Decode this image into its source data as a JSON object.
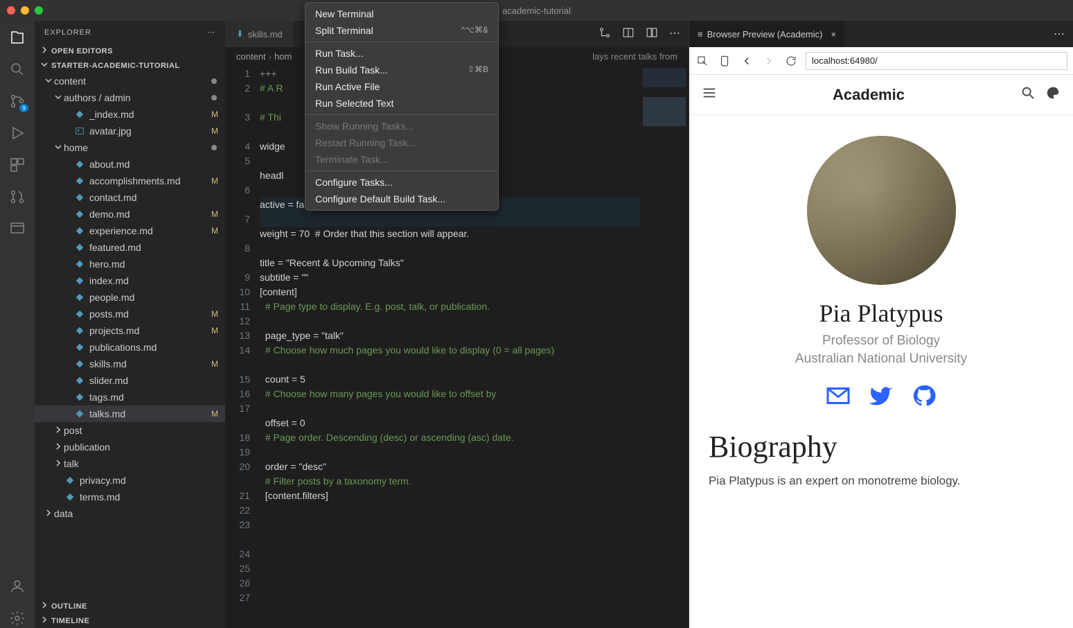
{
  "window": {
    "title": "academic-tutorial"
  },
  "explorer": {
    "title": "EXPLORER",
    "sections": {
      "open_editors": "OPEN EDITORS",
      "project": "STARTER-ACADEMIC-TUTORIAL",
      "outline": "OUTLINE",
      "timeline": "TIMELINE"
    },
    "tree": [
      {
        "label": "content",
        "kind": "folder",
        "depth": 0,
        "expanded": true,
        "status": "dot"
      },
      {
        "label": "authors / admin",
        "kind": "folder",
        "depth": 1,
        "expanded": true,
        "status": "dot"
      },
      {
        "label": "_index.md",
        "kind": "md",
        "depth": 2,
        "status": "M"
      },
      {
        "label": "avatar.jpg",
        "kind": "img",
        "depth": 2,
        "status": "M"
      },
      {
        "label": "home",
        "kind": "folder",
        "depth": 1,
        "expanded": true,
        "status": "dot"
      },
      {
        "label": "about.md",
        "kind": "md",
        "depth": 2
      },
      {
        "label": "accomplishments.md",
        "kind": "md",
        "depth": 2,
        "status": "M"
      },
      {
        "label": "contact.md",
        "kind": "md",
        "depth": 2
      },
      {
        "label": "demo.md",
        "kind": "md",
        "depth": 2,
        "status": "M"
      },
      {
        "label": "experience.md",
        "kind": "md",
        "depth": 2,
        "status": "M"
      },
      {
        "label": "featured.md",
        "kind": "md",
        "depth": 2
      },
      {
        "label": "hero.md",
        "kind": "md",
        "depth": 2
      },
      {
        "label": "index.md",
        "kind": "md",
        "depth": 2
      },
      {
        "label": "people.md",
        "kind": "md",
        "depth": 2
      },
      {
        "label": "posts.md",
        "kind": "md",
        "depth": 2,
        "status": "M"
      },
      {
        "label": "projects.md",
        "kind": "md",
        "depth": 2,
        "status": "M"
      },
      {
        "label": "publications.md",
        "kind": "md",
        "depth": 2
      },
      {
        "label": "skills.md",
        "kind": "md",
        "depth": 2,
        "status": "M"
      },
      {
        "label": "slider.md",
        "kind": "md",
        "depth": 2
      },
      {
        "label": "tags.md",
        "kind": "md",
        "depth": 2
      },
      {
        "label": "talks.md",
        "kind": "md",
        "depth": 2,
        "status": "M",
        "selected": true
      },
      {
        "label": "post",
        "kind": "folder",
        "depth": 1,
        "expanded": false
      },
      {
        "label": "publication",
        "kind": "folder",
        "depth": 1,
        "expanded": false
      },
      {
        "label": "talk",
        "kind": "folder",
        "depth": 1,
        "expanded": false
      },
      {
        "label": "privacy.md",
        "kind": "md",
        "depth": 1
      },
      {
        "label": "terms.md",
        "kind": "md",
        "depth": 1
      },
      {
        "label": "data",
        "kind": "folder",
        "depth": 0,
        "expanded": false
      }
    ]
  },
  "sourcecontrol_badge": "9",
  "editor": {
    "tab": "skills.md",
    "breadcrumb": [
      "content",
      "hom"
    ],
    "breadcrumb_tail": "lays recent talks from ",
    "lines": [
      {
        "n": 1,
        "text": "+++",
        "cls": "c-front"
      },
      {
        "n": 2,
        "text": "# A R                              reated with",
        "cls": "c-comment",
        "wrap": true
      },
      {
        "n": 3,
        "text": "# Thi                              m `content",
        "cls": "c-comment",
        "wrap": true
      },
      {
        "n": 4,
        "text": "",
        "cls": ""
      },
      {
        "n": 5,
        "text": "widge                              nemes.com/a",
        "cls": "",
        "wrap": true
      },
      {
        "n": 6,
        "text": "headl                              a page section.",
        "cls": "",
        "wrap": true
      },
      {
        "n": 7,
        "text": "active = false  # Activate this widget? true/false",
        "cls": "",
        "hl": true,
        "wrap": true
      },
      {
        "n": 8,
        "text": "weight = 70  # Order that this section will appear.",
        "cls": "",
        "wrap": true
      },
      {
        "n": 9,
        "text": "",
        "cls": ""
      },
      {
        "n": 10,
        "text": "title = \"Recent & Upcoming Talks\"",
        "cls": ""
      },
      {
        "n": 11,
        "text": "subtitle = \"\"",
        "cls": ""
      },
      {
        "n": 12,
        "text": "",
        "cls": ""
      },
      {
        "n": 13,
        "text": "[content]",
        "cls": "c-section"
      },
      {
        "n": 14,
        "text": "  # Page type to display. E.g. post, talk, or publication.",
        "cls": "c-comment",
        "wrap": true
      },
      {
        "n": 15,
        "text": "  page_type = \"talk\"",
        "cls": ""
      },
      {
        "n": 16,
        "text": "",
        "cls": ""
      },
      {
        "n": 17,
        "text": "  # Choose how much pages you would like to display (0 = all pages)",
        "cls": "c-comment",
        "wrap": true
      },
      {
        "n": 18,
        "text": "  count = 5",
        "cls": ""
      },
      {
        "n": 19,
        "text": "",
        "cls": ""
      },
      {
        "n": 20,
        "text": "  # Choose how many pages you would like to offset by",
        "cls": "c-comment",
        "wrap": true
      },
      {
        "n": 21,
        "text": "  offset = 0",
        "cls": ""
      },
      {
        "n": 22,
        "text": "",
        "cls": ""
      },
      {
        "n": 23,
        "text": "  # Page order. Descending (desc) or ascending (asc) date.",
        "cls": "c-comment",
        "wrap": true
      },
      {
        "n": 24,
        "text": "  order = \"desc\"",
        "cls": ""
      },
      {
        "n": 25,
        "text": "",
        "cls": ""
      },
      {
        "n": 26,
        "text": "  # Filter posts by a taxonomy term.",
        "cls": "c-comment"
      },
      {
        "n": 27,
        "text": "  [content.filters]",
        "cls": "c-section"
      }
    ]
  },
  "menu": {
    "items": [
      {
        "label": "New Terminal"
      },
      {
        "label": "Split Terminal",
        "shortcut": "^⌥⌘&"
      },
      {
        "sep": true
      },
      {
        "label": "Run Task..."
      },
      {
        "label": "Run Build Task...",
        "shortcut": "⇧⌘B"
      },
      {
        "label": "Run Active File"
      },
      {
        "label": "Run Selected Text"
      },
      {
        "sep": true
      },
      {
        "label": "Show Running Tasks...",
        "disabled": true
      },
      {
        "label": "Restart Running Task...",
        "disabled": true
      },
      {
        "label": "Terminate Task...",
        "disabled": true
      },
      {
        "sep": true
      },
      {
        "label": "Configure Tasks..."
      },
      {
        "label": "Configure Default Build Task..."
      }
    ]
  },
  "preview": {
    "tab_label": "Browser Preview (Academic)",
    "url": "localhost:64980/",
    "site_title": "Academic",
    "profile": {
      "name": "Pia Platypus",
      "role": "Professor of Biology",
      "org": "Australian National University"
    },
    "bio": {
      "heading": "Biography",
      "text": "Pia Platypus is an expert on monotreme biology."
    }
  }
}
